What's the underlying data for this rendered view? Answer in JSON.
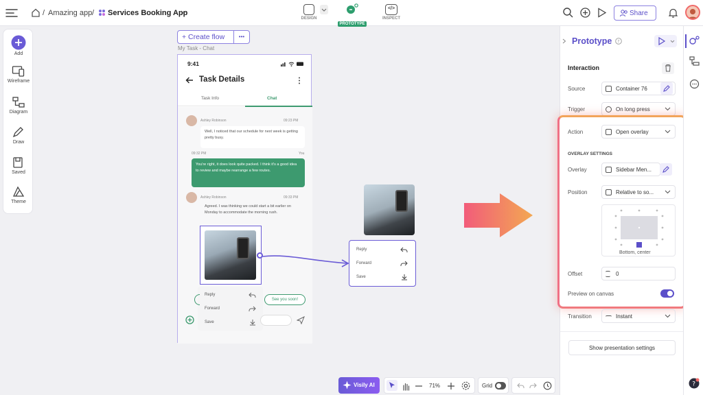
{
  "breadcrumb": {
    "project": "Amazing app",
    "separator": "/",
    "page": "Services Booking App"
  },
  "modes": {
    "design": "DESIGN",
    "prototype": "PROTOTYPE",
    "inspect": "INSPECT"
  },
  "topbar": {
    "share_label": "Share"
  },
  "tools": {
    "add": "Add",
    "wireframe": "Wireframe",
    "diagram": "Diagram",
    "draw": "Draw",
    "saved": "Saved",
    "theme": "Theme"
  },
  "canvas": {
    "create_flow_label": "+ Create flow",
    "more_label": "•••",
    "frame_label": "My Task - Chat"
  },
  "phone": {
    "time": "9:41",
    "title": "Task Details",
    "tabs": [
      "Task Info",
      "Chat"
    ],
    "msg1": {
      "sender": "Ashley Robinson",
      "time": "09:23 PM",
      "text": "Well, I noticed that our schedule for next week is getting pretty busy."
    },
    "msg2": {
      "time": "09:32 PM",
      "sender": "You",
      "text": "You're right, it does look quite packed. I think it's a good idea to review and maybe rearrange a few routes."
    },
    "msg3": {
      "sender": "Ashley Robinson",
      "time": "09:33 PM",
      "text": "Agreed. I was thinking we could start a bit earlier on Monday to accommodate the morning rush."
    },
    "menu": [
      "Reply",
      "Forward",
      "Save"
    ],
    "quick_reply": "See you soon!"
  },
  "overlay_menu": [
    "Reply",
    "Forward",
    "Save"
  ],
  "prototype_panel": {
    "title": "Prototype",
    "interaction_heading": "Interaction",
    "source_label": "Source",
    "source_value": "Container 76",
    "trigger_label": "Trigger",
    "trigger_value": "On long press",
    "action_label": "Action",
    "action_value": "Open overlay",
    "overlay_settings_heading": "OVERLAY SETTINGS",
    "overlay_label": "Overlay",
    "overlay_value": "Sidebar Men...",
    "position_label": "Position",
    "position_value": "Relative to so...",
    "position_caption": "Bottom, center",
    "offset_label": "Offset",
    "offset_value": "0",
    "preview_label": "Preview on canvas",
    "preview_on": true,
    "transition_label": "Transition",
    "transition_value": "Instant",
    "presentation_button": "Show presentation settings"
  },
  "bottombar": {
    "ai_label": "Visily AI",
    "zoom": "71%",
    "grid_label": "Grid"
  },
  "colors": {
    "accent": "#5b4fc9",
    "prototype_green": "#2e9e6e",
    "chat_green": "#3d9a6f",
    "highlight_orange": "#f2a45a",
    "highlight_pink": "#f06a80"
  }
}
